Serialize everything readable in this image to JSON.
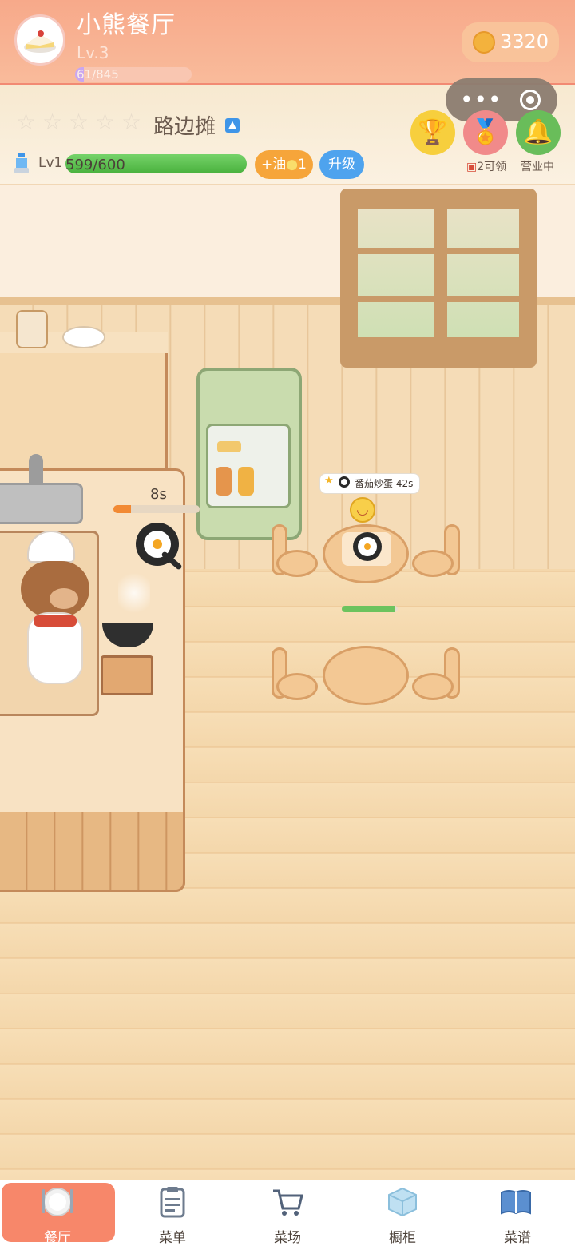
{
  "header": {
    "title": "小熊餐厅",
    "level": "Lv.3",
    "xp_text": "61/845",
    "xp_fraction": 0.072,
    "coins": "3320"
  },
  "miniprogram_capsule": {
    "menu_icon": "more-dots-icon",
    "close_icon": "target-icon"
  },
  "shop": {
    "rating_stars": 0,
    "rating_max": 5,
    "name": "路边摊",
    "upgrade_icon": "arrow-up-icon"
  },
  "top_buttons": {
    "trophy_icon": "trophy-icon",
    "medal_icon": "medal-icon",
    "reward_label": "2可领",
    "bell_icon": "bell-icon",
    "open_label": "营业中"
  },
  "oil": {
    "level": "Lv1",
    "value_text": "599/600",
    "fraction": 0.998,
    "add_oil_label": "+油",
    "add_oil_cost": "1",
    "upgrade_label": "升级"
  },
  "kitchen": {
    "cook_timer": "8s",
    "cook_progress": 0.2,
    "dish_icon": "fried-egg-icon"
  },
  "order": {
    "dish": "番茄炒蛋",
    "time_left": "42s",
    "patience": 0.95
  },
  "tabs": [
    {
      "label": "餐厅",
      "icon": "plate-icon",
      "active": true
    },
    {
      "label": "菜单",
      "icon": "clipboard-icon",
      "active": false
    },
    {
      "label": "菜场",
      "icon": "cart-icon",
      "active": false
    },
    {
      "label": "橱柜",
      "icon": "ice-cube-icon",
      "active": false
    },
    {
      "label": "菜谱",
      "icon": "book-icon",
      "active": false
    }
  ],
  "colors": {
    "header_bg": "#f7a98a",
    "coin": "#f3b23d",
    "oil_bar": "#49b13d",
    "add_oil_button": "#f6a53a",
    "upgrade_button": "#4ea3ee",
    "active_tab": "#f7876a"
  }
}
